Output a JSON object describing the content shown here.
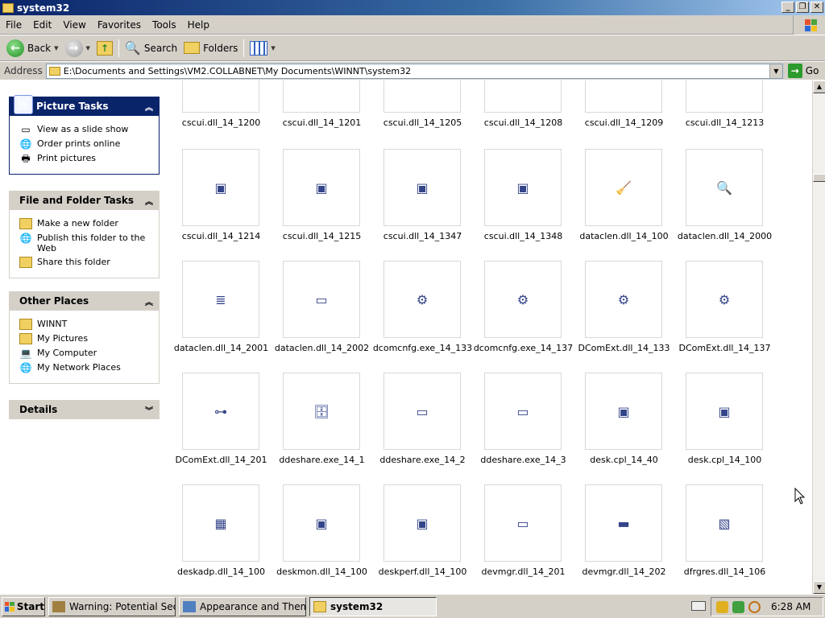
{
  "window": {
    "title": "system32"
  },
  "menu": [
    "File",
    "Edit",
    "View",
    "Favorites",
    "Tools",
    "Help"
  ],
  "toolbar": {
    "back_label": "Back",
    "search_label": "Search",
    "folders_label": "Folders"
  },
  "address": {
    "label": "Address",
    "value": "E:\\Documents and Settings\\VM2.COLLABNET\\My Documents\\WINNT\\system32",
    "go_label": "Go"
  },
  "left_panels": {
    "picture_tasks": {
      "title": "Picture Tasks",
      "items": [
        "View as a slide show",
        "Order prints online",
        "Print pictures"
      ]
    },
    "file_folder_tasks": {
      "title": "File and Folder Tasks",
      "items": [
        "Make a new folder",
        "Publish this folder to the Web",
        "Share this folder"
      ]
    },
    "other_places": {
      "title": "Other Places",
      "items": [
        "WINNT",
        "My Pictures",
        "My Computer",
        "My Network Places"
      ]
    },
    "details": {
      "title": "Details"
    }
  },
  "files": [
    [
      "cscui.dll_14_1200",
      "cscui.dll_14_1201",
      "cscui.dll_14_1205",
      "cscui.dll_14_1208",
      "cscui.dll_14_1209",
      "cscui.dll_14_1213"
    ],
    [
      "cscui.dll_14_1214",
      "cscui.dll_14_1215",
      "cscui.dll_14_1347",
      "cscui.dll_14_1348",
      "dataclen.dll_14_100",
      "dataclen.dll_14_2000"
    ],
    [
      "dataclen.dll_14_2001",
      "dataclen.dll_14_2002",
      "dcomcnfg.exe_14_133",
      "dcomcnfg.exe_14_137",
      "DComExt.dll_14_133",
      "DComExt.dll_14_137"
    ],
    [
      "DComExt.dll_14_201",
      "ddeshare.exe_14_1",
      "ddeshare.exe_14_2",
      "ddeshare.exe_14_3",
      "desk.cpl_14_40",
      "desk.cpl_14_100"
    ],
    [
      "deskadp.dll_14_100",
      "deskmon.dll_14_100",
      "deskperf.dll_14_100",
      "devmgr.dll_14_201",
      "devmgr.dll_14_202",
      "dfrgres.dll_14_106"
    ]
  ],
  "taskbar": {
    "start_label": "Start",
    "tasks": [
      "Warning: Potential Secur...",
      "Appearance and Themes",
      "system32"
    ],
    "clock": "6:28 AM"
  }
}
